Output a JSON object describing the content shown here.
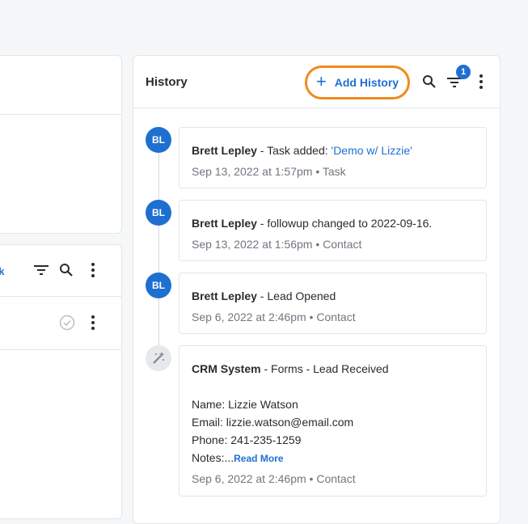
{
  "left_panel": {
    "task_link_label": "sk"
  },
  "history": {
    "title": "History",
    "add_label": "Add History",
    "filter_count": "1",
    "entries": [
      {
        "initials": "BL",
        "author": "Brett Lepley",
        "separator": " - ",
        "text": "Task added: ",
        "task_name": "'Demo w/ Lizzie'",
        "meta": "Sep 13, 2022 at 1:57pm • Task"
      },
      {
        "initials": "BL",
        "author": "Brett Lepley",
        "separator": " - ",
        "text": "followup changed to 2022-09-16.",
        "meta": "Sep 13, 2022 at 1:56pm • Contact"
      },
      {
        "initials": "BL",
        "author": "Brett Lepley",
        "separator": " - ",
        "text": "Lead Opened",
        "meta": "Sep 6, 2022 at 2:46pm • Contact"
      },
      {
        "author": "CRM System",
        "separator": " - ",
        "text": "Forms - Lead Received",
        "name_line": "Name: Lizzie Watson",
        "email_line": "Email: lizzie.watson@email.com",
        "phone_line": "Phone: 241-235-1259",
        "notes_prefix": "Notes:...",
        "read_more": "Read More",
        "meta": "Sep 6, 2022 at 2:46pm • Contact"
      }
    ]
  },
  "colors": {
    "accent": "#1f6fd1",
    "highlight": "#f08a1e",
    "muted": "#707780"
  }
}
